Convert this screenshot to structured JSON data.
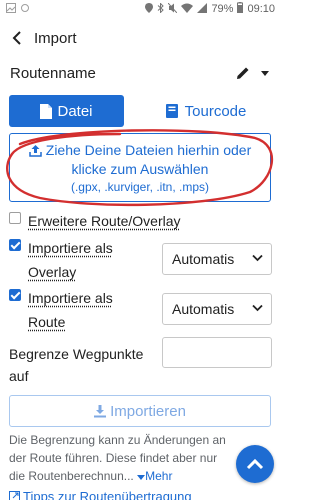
{
  "status": {
    "battery": "79%",
    "time": "09:10"
  },
  "header": {
    "title": "Import"
  },
  "route_name": {
    "label": "Routenname"
  },
  "tabs": [
    {
      "label": "Datei",
      "active": true
    },
    {
      "label": "Tourcode",
      "active": false
    }
  ],
  "dropzone": {
    "line1": "Ziehe Deine Dateien hierhin oder",
    "line2": "klicke zum Auswählen",
    "line3": "(.gpx, .kurviger, .itn, .mps)"
  },
  "options": {
    "extended_route": {
      "label": "Erweitere Route/Overlay",
      "checked": false
    },
    "import_overlay": {
      "label_line1": "Importiere als",
      "label_line2": "Overlay",
      "checked": true,
      "select": "Automatis"
    },
    "import_route": {
      "label_line1": "Importiere als",
      "label_line2": "Route",
      "checked": true,
      "select": "Automatis"
    }
  },
  "limit": {
    "label_line1": "Begrenze Wegpunkte",
    "label_line2": "auf",
    "value": ""
  },
  "import_button": {
    "label": "Importieren"
  },
  "info": {
    "line1": "Die Begrenzung kann zu Änderungen an",
    "line2": "der Route führen. Diese findet aber nur",
    "line3": "die Routenberechnun...",
    "more": "Mehr"
  },
  "bottom_link": {
    "label": "Tipps zur Routenübertragung"
  },
  "colors": {
    "accent": "#1e6cd2",
    "annotation": "#d32f2f"
  }
}
